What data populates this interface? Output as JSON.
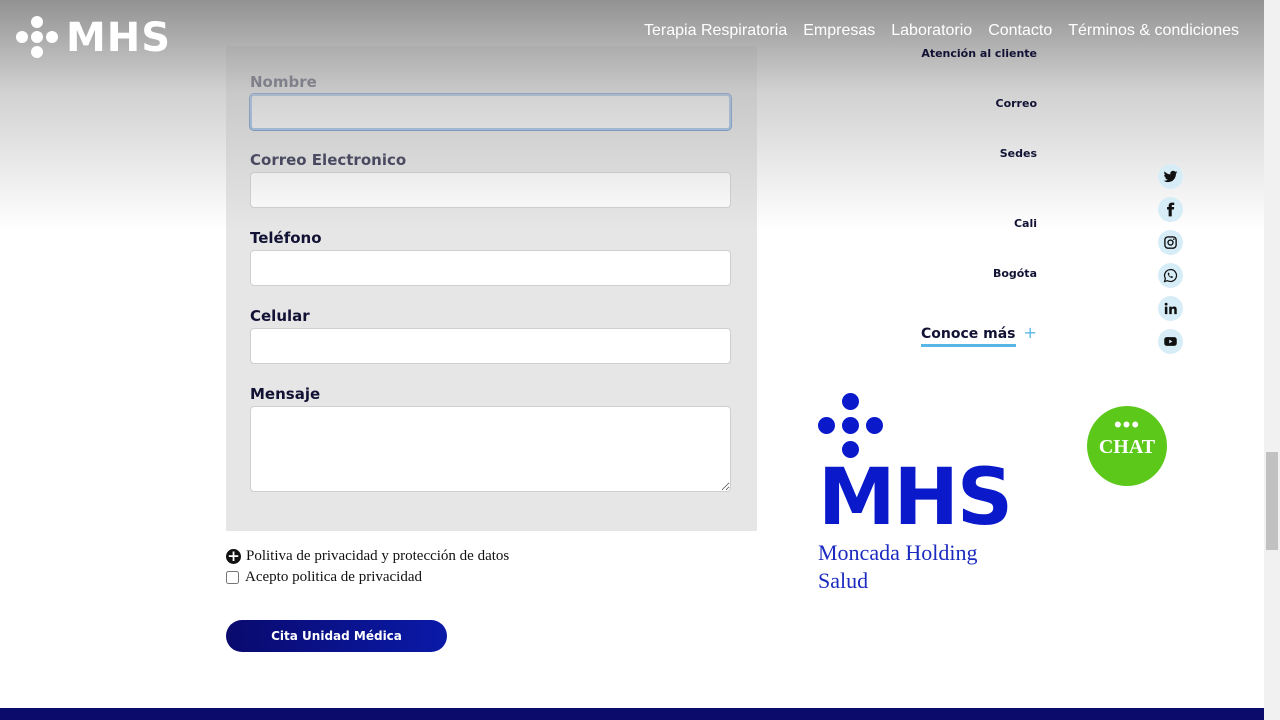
{
  "header": {
    "logo_text": "MHS",
    "nav": [
      "Terapia Respiratoria",
      "Empresas",
      "Laboratorio",
      "Contacto",
      "Términos & condiciones"
    ]
  },
  "form": {
    "fields": [
      {
        "label": "Nombre",
        "value": ""
      },
      {
        "label": "Correo Electronico",
        "value": ""
      },
      {
        "label": "Teléfono",
        "value": ""
      },
      {
        "label": "Celular",
        "value": ""
      },
      {
        "label": "Mensaje",
        "value": ""
      }
    ],
    "privacy_link": "Politiva de privacidad y protección de datos",
    "accept_label": "Acepto politica de privacidad",
    "accept_checked": false,
    "submit_label": "Cita Unidad Médica"
  },
  "info": {
    "atencion": "Atención al cliente",
    "correo": "Correo",
    "sedes": "Sedes",
    "cali": "Cali",
    "bogota": "Bogóta",
    "conoce_mas": "Conoce más",
    "conoce_plus": "+"
  },
  "social": [
    "twitter-icon",
    "facebook-icon",
    "instagram-icon",
    "whatsapp-icon",
    "linkedin-icon",
    "youtube-icon"
  ],
  "brand": {
    "word": "MHS",
    "subtitle_line1": "Moncada Holding",
    "subtitle_line2": "Salud"
  },
  "chat": {
    "dots": "•••",
    "label": "CHAT",
    "color": "#5cc91a"
  },
  "colors": {
    "brand_blue": "#0a1acb",
    "navy": "#0b0b6b",
    "accent_light_blue": "#59b7e8"
  }
}
